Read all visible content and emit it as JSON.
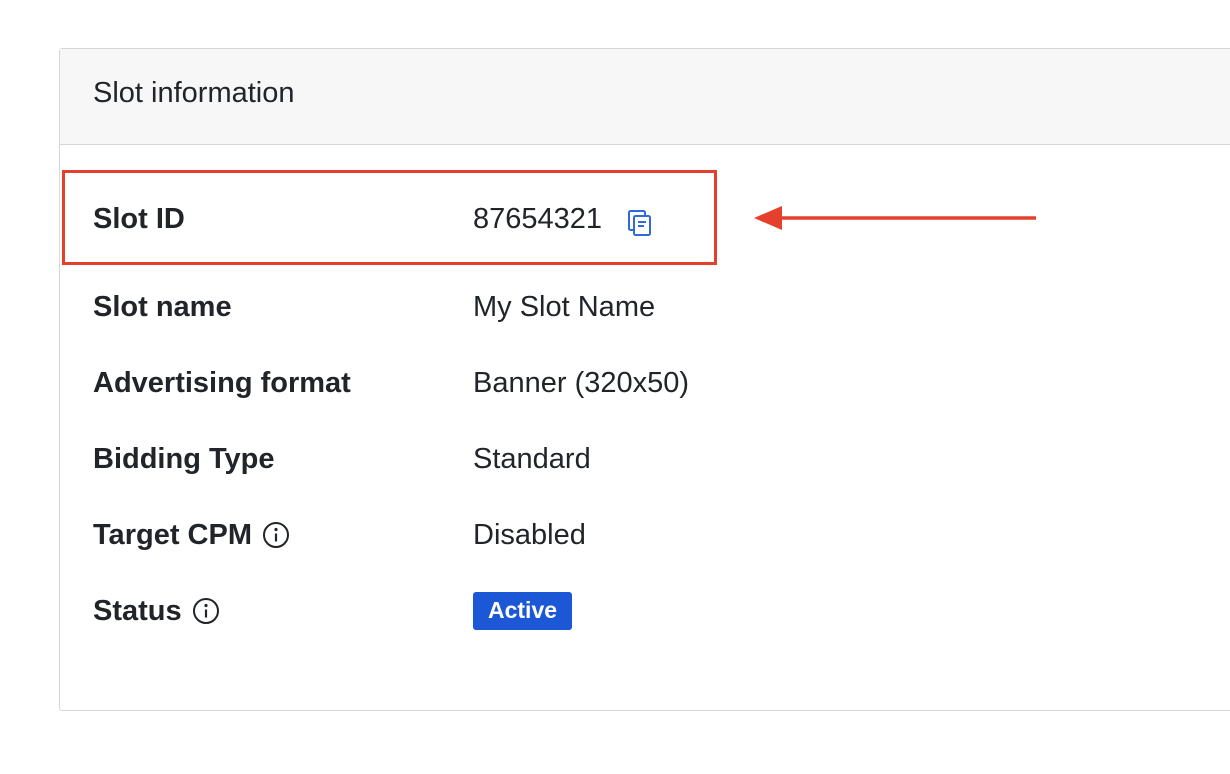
{
  "card": {
    "title": "Slot information"
  },
  "rows": [
    {
      "label": "Slot ID",
      "value": "87654321"
    },
    {
      "label": "Slot name",
      "value": "My Slot Name"
    },
    {
      "label": "Advertising format",
      "value": "Banner (320x50)"
    },
    {
      "label": "Bidding Type",
      "value": "Standard"
    },
    {
      "label": "Target CPM",
      "value": "Disabled"
    },
    {
      "label": "Status",
      "value": "Active"
    }
  ],
  "icons": {
    "copy": "copy-icon",
    "info": "info-circle-icon"
  },
  "colors": {
    "annotation": "#e5402b",
    "badge": "#1c57d6",
    "copy_icon": "#2f6bd8"
  }
}
